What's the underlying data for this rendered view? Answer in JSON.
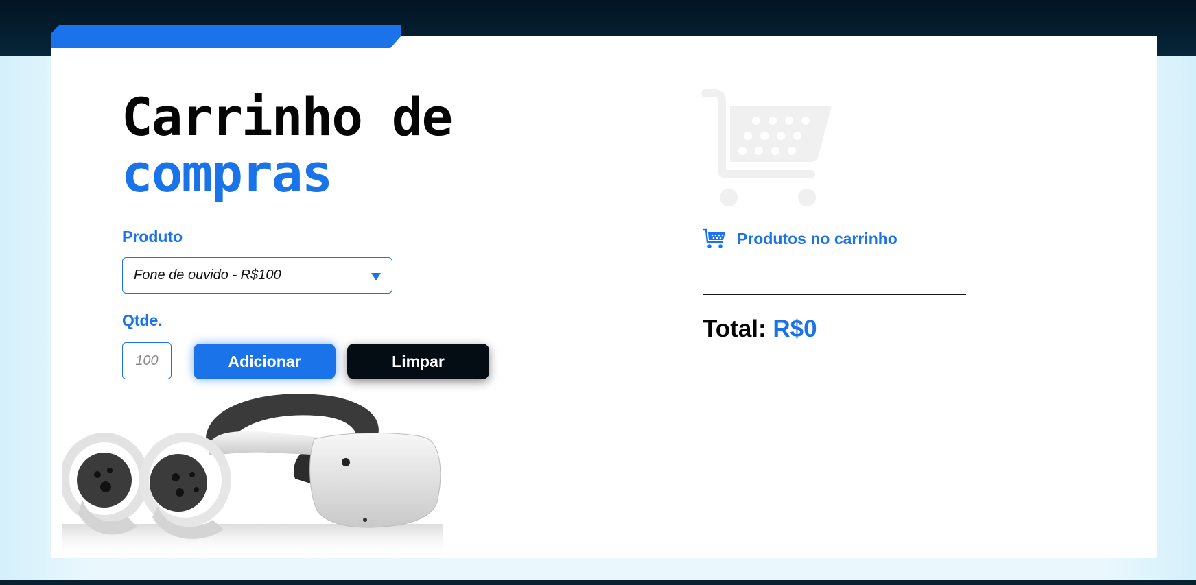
{
  "header": {
    "title_line1": "Carrinho de",
    "title_line2": "compras"
  },
  "form": {
    "product_label": "Produto",
    "product_selected": "Fone de ouvido - R$100",
    "qty_label": "Qtde.",
    "qty_placeholder": "100",
    "add_button": "Adicionar",
    "clear_button": "Limpar"
  },
  "cart": {
    "title": "Produtos no carrinho",
    "items": [],
    "total_label": "Total:",
    "total_value": "R$0"
  },
  "colors": {
    "accent": "#1a73e8",
    "dark": "#050d14",
    "header_band": "#021422",
    "background": "#dff4fb",
    "card": "#ffffff"
  },
  "icons": {
    "cart_watermark": "shopping-cart-icon",
    "cart_heading": "shopping-cart-icon",
    "select_arrow": "triangle-down-icon",
    "product_image": "vr-headset-image"
  }
}
